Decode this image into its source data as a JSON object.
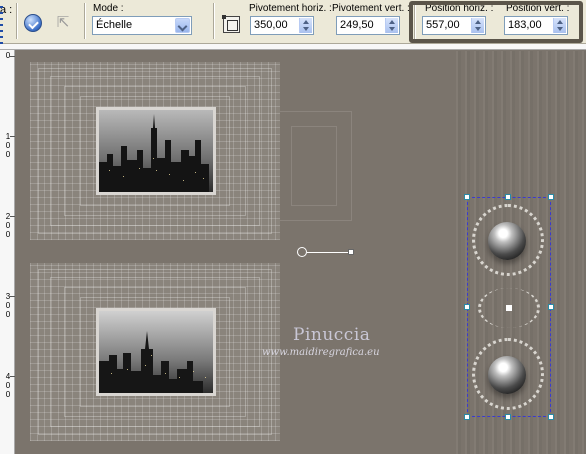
{
  "toolbar": {
    "truncated_label": "a :",
    "mode_label": "Mode :",
    "mode_value": "Échelle",
    "pivot_h_label": "Pivotement horiz. :",
    "pivot_h_value": "350,00",
    "pivot_v_label": "Pivotement vert. :",
    "pivot_v_value": "249,50",
    "pos_h_label": "Position horiz. :",
    "pos_h_value": "557,00",
    "pos_v_label": "Position vert. :",
    "pos_v_value": "183,00"
  },
  "ruler": {
    "labels": [
      "0",
      "100",
      "200",
      "300",
      "400"
    ]
  },
  "watermark": {
    "name": "Pinuccia",
    "url": "www.maidiregrafica.eu"
  },
  "colors": {
    "canvas": "#7b746c",
    "toolbar": "#ece9d8",
    "selection": "#3a3ad0",
    "highlight_box": "#5b554a"
  },
  "icons": [
    "apply-icon",
    "pick-tool-icon",
    "scale-mode-icon",
    "pivot-icon",
    "chevron-down-icon",
    "spin-arrows-icon"
  ]
}
